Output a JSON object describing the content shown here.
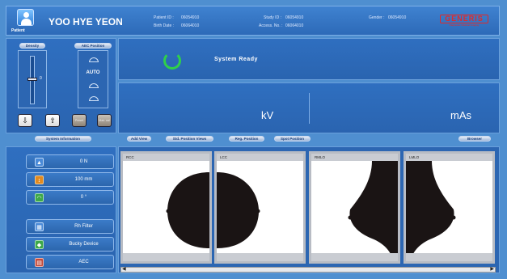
{
  "header": {
    "role_label": "Patient",
    "patient_name": "YOO HYE YEON",
    "patient_id_label": "Patient ID :",
    "patient_id": "06054910",
    "birth_date_label": "Birth Date :",
    "birth_date": "06064010",
    "study_id_label": "Study ID :",
    "study_id": "06054910",
    "access_no_label": "Access. No. :",
    "access_no": "06064010",
    "gender_label": "Gender :",
    "gender": "06054910",
    "logo_text": "GENERIS",
    "logo_tagline": "Diagnostic Medical Imaging"
  },
  "left_panel": {
    "density_label": "Density",
    "density_value": "0",
    "aec_label": "AEC Position",
    "aec_mode": "AUTO",
    "preset_label": "Preset",
    "manual_label": "Man. ual"
  },
  "status": {
    "message": "System Ready",
    "kv_label": "kV",
    "mas_label": "mAs"
  },
  "toolbar": {
    "system_info": "System Information",
    "add_view": "Add View",
    "std_position_views": "Std. Position Views",
    "reg_position": "Reg. Position",
    "spot_position": "Spot Position",
    "browser": "Browser"
  },
  "system_info": {
    "force": "0 N",
    "thickness": "100 mm",
    "angle": "0 °",
    "rh_filter": "Rh Filter",
    "bucky_device": "Bucky Device",
    "aec": "AEC"
  },
  "views": [
    {
      "label": "RCC"
    },
    {
      "label": "LCC"
    },
    {
      "label": "RMLO"
    },
    {
      "label": "LMLO"
    }
  ],
  "colors": {
    "background": "#4f8fd0",
    "panel": "#2f6fc0",
    "ready_ring": "#2fd04a",
    "logo": "#e02a2a"
  }
}
